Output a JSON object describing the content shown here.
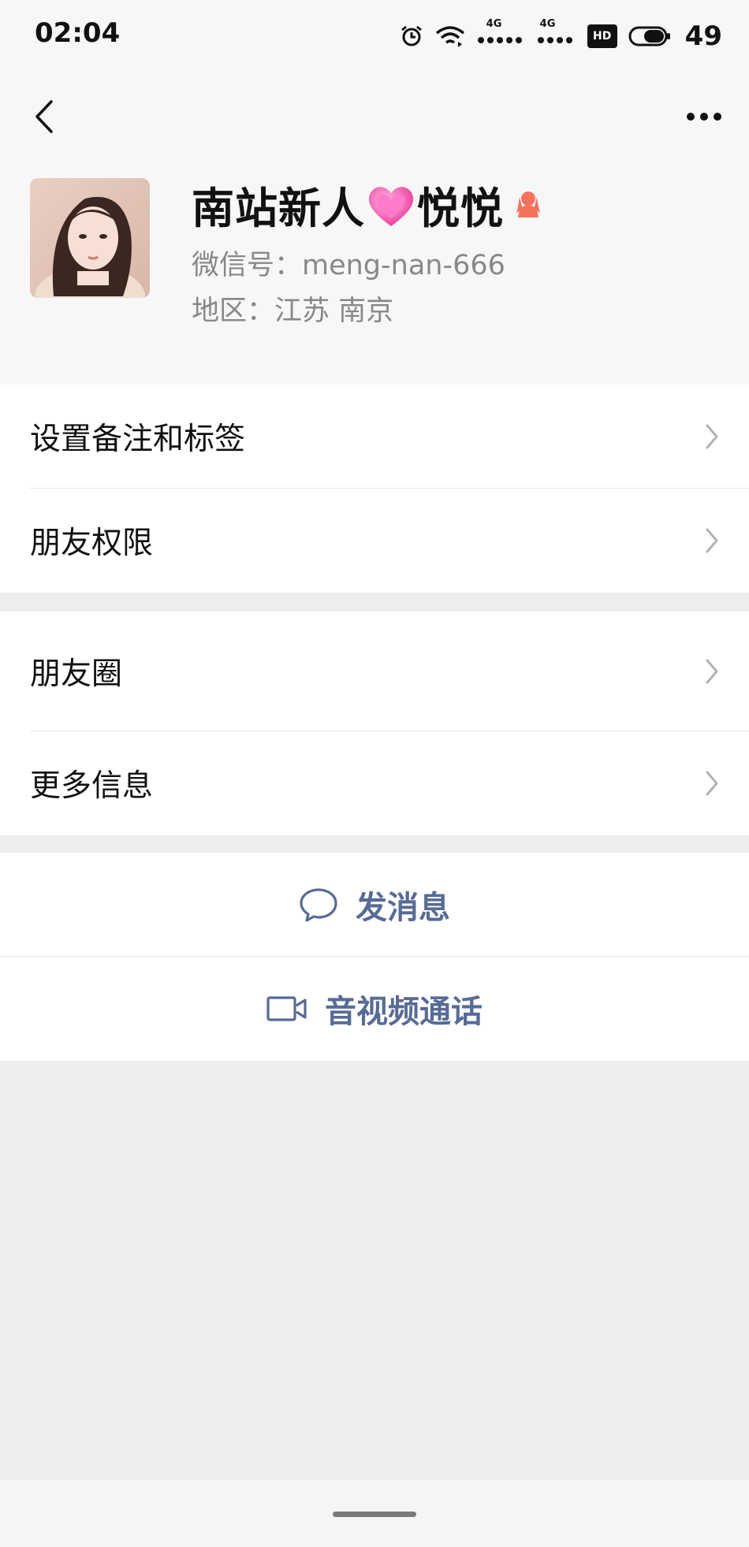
{
  "status_bar": {
    "time": "02:04",
    "network_label_1": "4G",
    "network_label_2": "4G",
    "hd_label": "HD",
    "battery": "49"
  },
  "nav": {
    "back_icon": "chevron-left-icon",
    "more_icon": "more-dots-icon"
  },
  "profile": {
    "name_part1": "南站新人",
    "name_part2": "悦悦",
    "wechat_id": "微信号：meng-nan-666",
    "region": "地区：江苏  南京",
    "gender_icon": "female-icon",
    "gender_color": "#f5735d"
  },
  "menu_group_1": [
    {
      "label": "设置备注和标签"
    },
    {
      "label": "朋友权限"
    }
  ],
  "menu_group_2": [
    {
      "label": "朋友圈"
    },
    {
      "label": "更多信息"
    }
  ],
  "actions": {
    "message_label": "发消息",
    "call_label": "音视频通话",
    "accent_color": "#576b95"
  }
}
